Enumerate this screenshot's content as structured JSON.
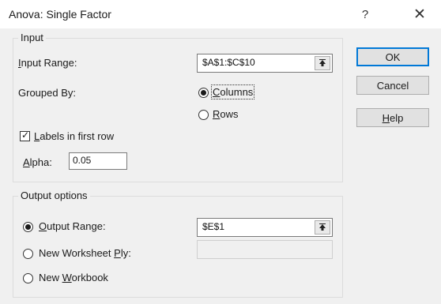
{
  "window": {
    "title": "Anova: Single Factor",
    "help_glyph": "?",
    "close_glyph": "✕"
  },
  "input_group": {
    "legend": "Input",
    "input_range_label": "Input Range:",
    "input_range_value": "$A$1:$C$10",
    "grouped_by_label": "Grouped By:",
    "grouped_by_options": [
      "Columns",
      "Rows"
    ],
    "grouped_by_selected": "Columns",
    "labels_checkbox": "Labels in first row",
    "labels_checked": true,
    "alpha_label": "Alpha:",
    "alpha_value": "0.05"
  },
  "output_group": {
    "legend": "Output options",
    "options": [
      "Output Range:",
      "New Worksheet Ply:",
      "New Workbook"
    ],
    "selected": "Output Range:",
    "output_range_value": "$E$1",
    "new_sheet_value": ""
  },
  "buttons": {
    "ok": "OK",
    "cancel": "Cancel",
    "help": "Help"
  },
  "icons": [
    "collapse-dialog-icon",
    "help-icon",
    "close-icon",
    "checkmark-icon"
  ]
}
